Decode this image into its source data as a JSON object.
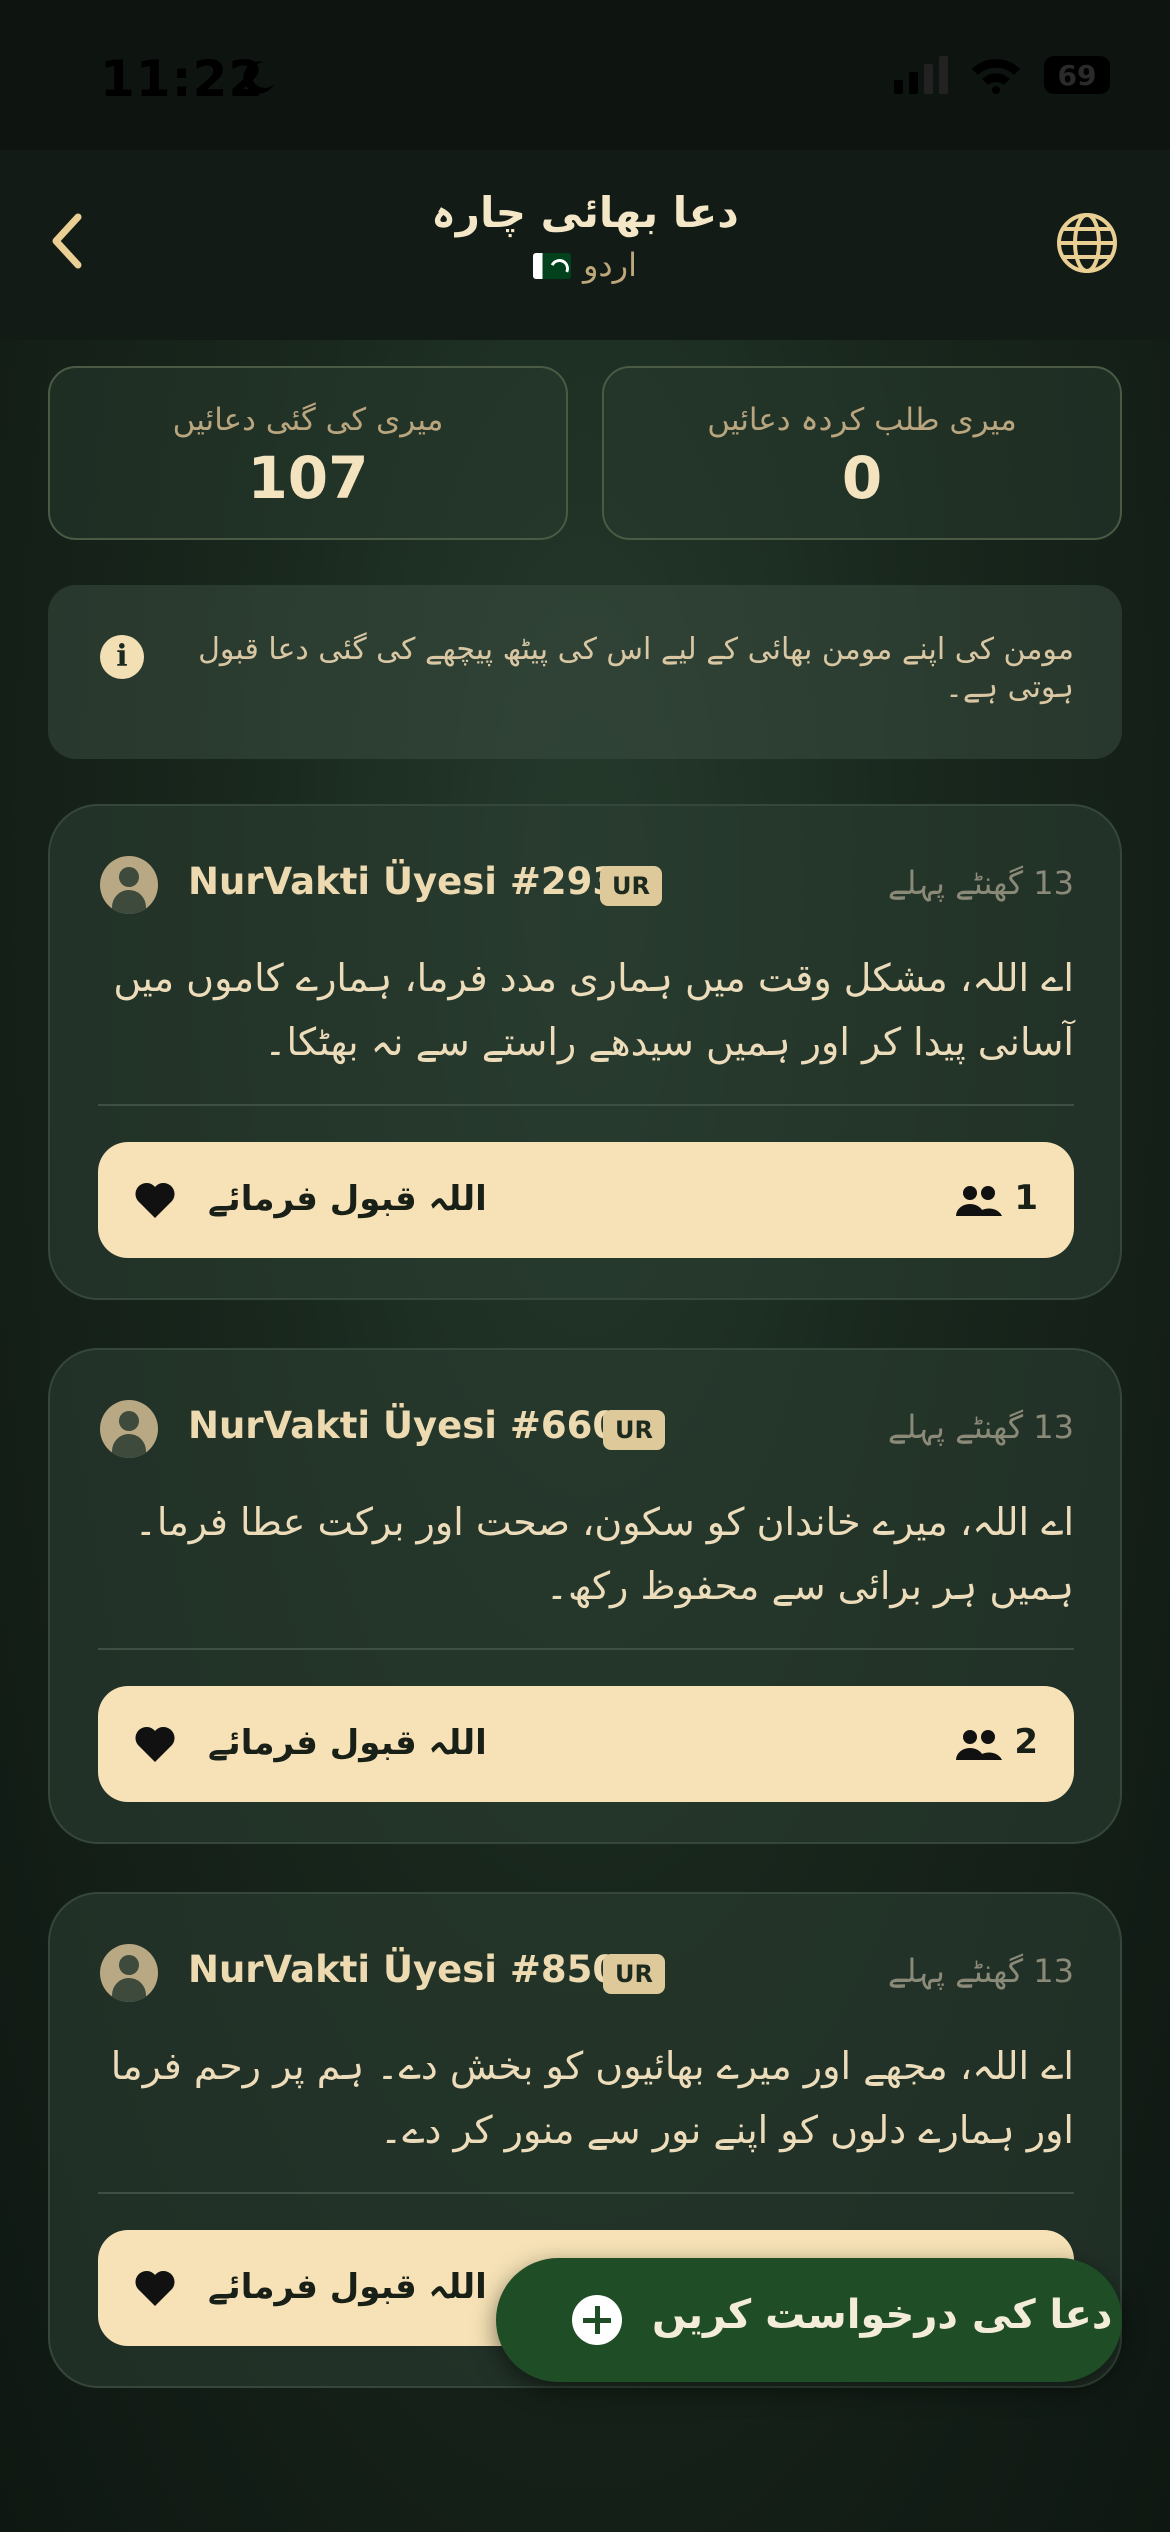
{
  "status_bar": {
    "time": "11:22",
    "battery": "69"
  },
  "header": {
    "title": "دعا بھائی چارہ",
    "language": "اردو",
    "icons": {
      "back": "chevron-left-icon",
      "language": "globe-icon"
    }
  },
  "stats": [
    {
      "label": "میری کی گئی دعائیں",
      "value": "107"
    },
    {
      "label": "میری طلب کردہ دعائیں",
      "value": "0"
    }
  ],
  "info": {
    "icon": "info-icon",
    "text": "مومن کی اپنے مومن بھائی کے لیے اس کی پیٹھ پیچھے کی گئی دعا قبول ہوتی ہے۔"
  },
  "prayers": [
    {
      "user": "NurVakti Üyesi #2935",
      "lang": "UR",
      "time": "13 گھنٹے پہلے",
      "text": "اے اللہ، مشکل وقت میں ہماری مدد فرما، ہمارے کاموں میں آسانی پیدا کر اور ہمیں سیدھے راستے سے نہ بھٹکا۔",
      "button": "اللہ قبول فرمائے",
      "count": "1"
    },
    {
      "user": "NurVakti Üyesi #6606",
      "lang": "UR",
      "time": "13 گھنٹے پہلے",
      "text": "اے اللہ، میرے خاندان کو سکون، صحت اور برکت عطا فرما۔ ہمیں ہر برائی سے محفوظ رکھ۔",
      "button": "اللہ قبول فرمائے",
      "count": "2"
    },
    {
      "user": "NurVakti Üyesi #8500",
      "lang": "UR",
      "time": "13 گھنٹے پہلے",
      "text": "اے اللہ، مجھے اور میرے بھائیوں کو بخش دے۔ ہم پر رحم فرما اور ہمارے دلوں کو اپنے نور سے منور کر دے۔",
      "button": "اللہ قبول فرمائے"
    }
  ],
  "fab": {
    "label": "دعا کی درخواست کریں",
    "icon": "plus-circle-icon"
  },
  "colors": {
    "accent": "#f6e2b6",
    "fab": "#1f4d25",
    "background": "#18261c"
  }
}
